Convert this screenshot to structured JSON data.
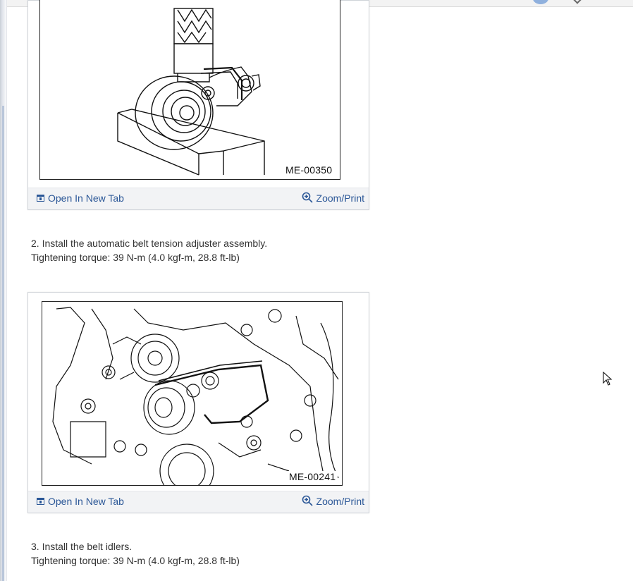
{
  "figures": [
    {
      "code": "ME-00350",
      "open_tab_label": "Open In New Tab",
      "zoom_label": "Zoom/Print"
    },
    {
      "code": "ME-00241",
      "open_tab_label": "Open In New Tab",
      "zoom_label": "Zoom/Print"
    }
  ],
  "steps": [
    {
      "text": "2. Install the automatic belt tension adjuster assembly.",
      "torque": "Tightening torque: 39 N-m (4.0 kgf-m, 28.8 ft-lb)"
    },
    {
      "text": "3. Install the belt idlers.",
      "torque": "Tightening torque: 39 N-m (4.0 kgf-m, 28.8 ft-lb)"
    }
  ],
  "colors": {
    "link": "#2b5797",
    "text": "#333333",
    "footer_bg": "#f2f3f5"
  },
  "icons": {
    "open_tab": "open-in-new-tab-icon",
    "zoom": "zoom-in-icon",
    "cursor": "mouse-pointer-icon"
  }
}
